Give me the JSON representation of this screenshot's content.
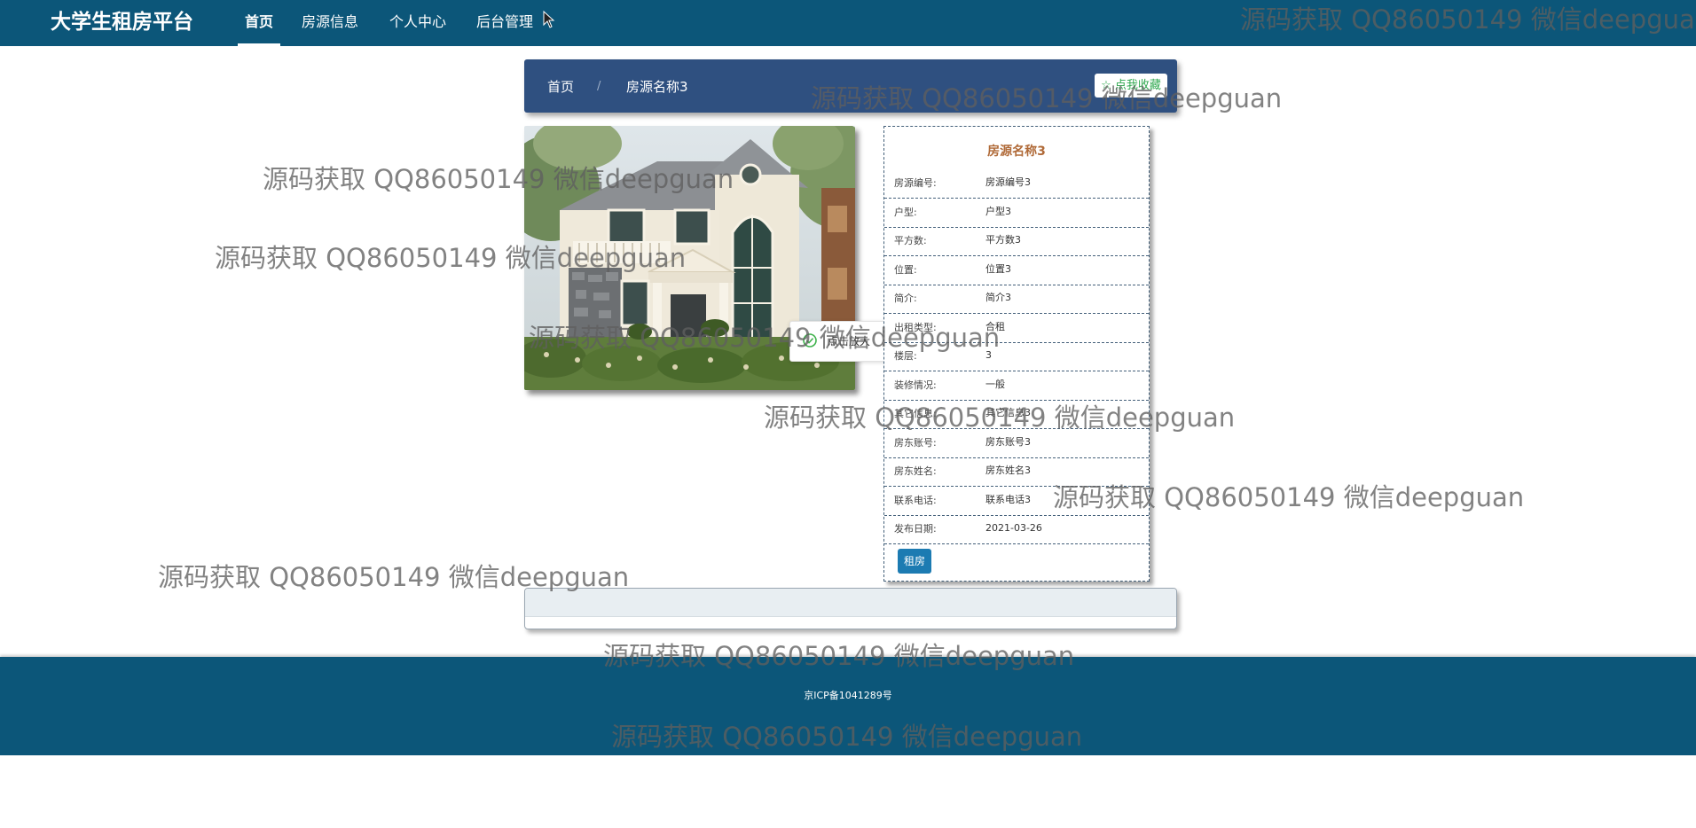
{
  "header": {
    "brand": "大学生租房平台",
    "nav": [
      "首页",
      "房源信息",
      "个人中心",
      "后台管理"
    ],
    "active_index": 0
  },
  "breadcrumb": {
    "home": "首页",
    "separator": "/",
    "current": "房源名称3",
    "favorite_label": "☆ 点我收藏"
  },
  "tooltip": {
    "text": "点击放大",
    "icon": "success-check-icon"
  },
  "detail": {
    "title": "房源名称3",
    "fields": [
      {
        "label": "房源编号:",
        "value": "房源编号3"
      },
      {
        "label": "户型:",
        "value": "户型3"
      },
      {
        "label": "平方数:",
        "value": "平方数3"
      },
      {
        "label": "位置:",
        "value": "位置3"
      },
      {
        "label": "简介:",
        "value": "简介3"
      },
      {
        "label": "出租类型:",
        "value": "合租"
      },
      {
        "label": "楼层:",
        "value": "3"
      },
      {
        "label": "装修情况:",
        "value": "一般"
      },
      {
        "label": "其它信息:",
        "value": "其它信息3"
      },
      {
        "label": "房东账号:",
        "value": "房东账号3"
      },
      {
        "label": "房东姓名:",
        "value": "房东姓名3"
      },
      {
        "label": "联系电话:",
        "value": "联系电话3"
      },
      {
        "label": "发布日期:",
        "value": "2021-03-26"
      }
    ],
    "rent_button": "租房"
  },
  "footer": {
    "icp": "京ICP备1041289号"
  },
  "watermark_text": "源码获取 QQ86050149 微信deepguan",
  "colors": {
    "nav_bg": "#0c5679",
    "crumb_bg": "#2f5080",
    "title_color": "#b06a38",
    "rent_button": "#1c7bb2",
    "favorite_text": "#2fa84f"
  }
}
